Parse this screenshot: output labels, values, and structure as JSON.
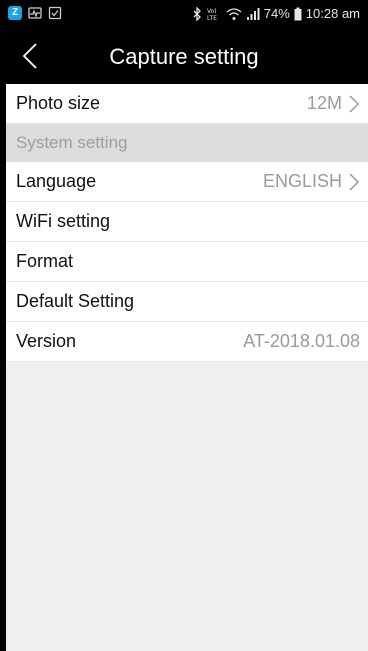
{
  "status_bar": {
    "app_icon_glyph": "Z",
    "battery": "74%",
    "time": "10:28 am",
    "left_icons": [
      "app-icon",
      "activity-icon",
      "checkbox-icon"
    ],
    "right_icons": [
      "bluetooth-icon",
      "volte-icon",
      "wifi-icon",
      "signal-icon",
      "battery-icon"
    ]
  },
  "header": {
    "title": "Capture setting",
    "back_icon": "chevron-left-icon"
  },
  "settings": {
    "photo_size": {
      "label": "Photo size",
      "value": "12M"
    },
    "system_section": "System setting",
    "language": {
      "label": "Language",
      "value": "ENGLISH"
    },
    "wifi": {
      "label": "WiFi setting"
    },
    "format": {
      "label": "Format"
    },
    "default": {
      "label": "Default Setting"
    },
    "version": {
      "label": "Version",
      "value": "AT-2018.01.08"
    }
  },
  "colors": {
    "background": "#efefef",
    "section_header_bg": "#dcdcdc",
    "muted_text": "#9a9a9a",
    "bar_bg": "#000000"
  }
}
